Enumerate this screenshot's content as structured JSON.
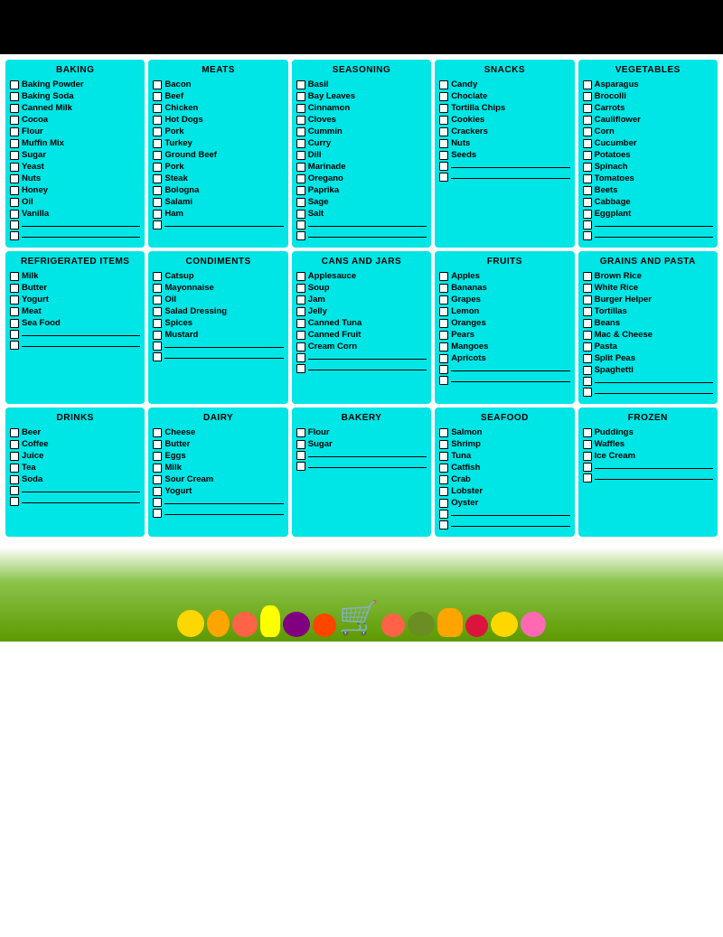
{
  "categories": [
    {
      "id": "baking",
      "title": "BAKING",
      "items": [
        "Baking Powder",
        "Baking Soda",
        "Canned Milk",
        "Cocoa",
        "Flour",
        "Muffin Mix",
        "Sugar",
        "Yeast",
        "Nuts",
        "Honey",
        "Oil",
        "Vanilla"
      ],
      "blanks": 2
    },
    {
      "id": "meats",
      "title": "MEATS",
      "items": [
        "Bacon",
        "Beef",
        "Chicken",
        "Hot Dogs",
        "Pork",
        "Turkey",
        "Ground Beef",
        "Pork",
        "Steak",
        "Bologna",
        "Salami",
        "Ham"
      ],
      "blanks": 1
    },
    {
      "id": "seasoning",
      "title": "SEASONING",
      "items": [
        "Basil",
        "Bay Leaves",
        "Cinnamon",
        "Cloves",
        "Cummin",
        "Curry",
        "Dill",
        "Marinade",
        "Oregano",
        "Paprika",
        "Sage",
        "Salt"
      ],
      "blanks": 2
    },
    {
      "id": "snacks",
      "title": "SNACKS",
      "items": [
        "Candy",
        "Choclate",
        "Tortilla Chips",
        "Cookies",
        "Crackers",
        "Nuts",
        "Seeds"
      ],
      "blanks": 2
    },
    {
      "id": "vegetables",
      "title": "VEGETABLES",
      "items": [
        "Asparagus",
        "Brocolli",
        "Carrots",
        "Cauliflower",
        "Corn",
        "Cucumber",
        "Potatoes",
        "Spinach",
        "Tomatoes",
        "Beets",
        "Cabbage",
        "Eggplant"
      ],
      "blanks": 2
    },
    {
      "id": "refrigerated",
      "title": "REFRIGERATED ITEMS",
      "items": [
        "Milk",
        "Butter",
        "Yogurt",
        "Meat",
        "Sea Food"
      ],
      "blanks": 2
    },
    {
      "id": "condiments",
      "title": "CONDIMENTS",
      "items": [
        "Catsup",
        "Mayonnaise",
        "Oil",
        "Salad Dressing",
        "Spices",
        "Mustard"
      ],
      "blanks": 2
    },
    {
      "id": "cans-jars",
      "title": "CANS AND JARS",
      "items": [
        "Applesauce",
        "Soup",
        "Jam",
        "Jelly",
        "Canned Tuna",
        "Canned Fruit",
        "Cream Corn"
      ],
      "blanks": 2
    },
    {
      "id": "fruits",
      "title": "FRUITS",
      "items": [
        "Apples",
        "Bananas",
        "Grapes",
        "Lemon",
        "Oranges",
        "Pears",
        "Mangoes",
        "Apricots"
      ],
      "blanks": 2
    },
    {
      "id": "grains-pasta",
      "title": "GRAINS AND PASTA",
      "items": [
        "Brown Rice",
        "White Rice",
        "Burger Helper",
        "Tortillas",
        "Beans",
        "Mac & Cheese",
        "Pasta",
        "Split Peas",
        "Spaghetti"
      ],
      "blanks": 2
    },
    {
      "id": "drinks",
      "title": "DRINKS",
      "items": [
        "Beer",
        "Coffee",
        "Juice",
        "Tea",
        "Soda"
      ],
      "blanks": 2
    },
    {
      "id": "dairy",
      "title": "DAIRY",
      "items": [
        "Cheese",
        "Butter",
        "Eggs",
        "Milk",
        "Sour Cream",
        "Yogurt"
      ],
      "blanks": 2
    },
    {
      "id": "bakery",
      "title": "BAKERY",
      "items": [
        "Flour",
        "Sugar"
      ],
      "blanks": 2
    },
    {
      "id": "seafood",
      "title": "SEAFOOD",
      "items": [
        "Salmon",
        "Shrimp",
        "Tuna",
        "Catfish",
        "Crab",
        "Lobster",
        "Oyster"
      ],
      "blanks": 2
    },
    {
      "id": "frozen",
      "title": "FROZEN",
      "items": [
        "Puddings",
        "Waffles",
        "Ice Cream"
      ],
      "blanks": 2
    }
  ],
  "layout": [
    [
      "baking",
      "meats",
      "seasoning",
      "snacks",
      "vegetables"
    ],
    [
      "refrigerated",
      "condiments",
      "cans-jars",
      "fruits",
      "grains-pasta"
    ],
    [
      "drinks",
      "dairy",
      "bakery",
      "seafood",
      "frozen"
    ]
  ]
}
